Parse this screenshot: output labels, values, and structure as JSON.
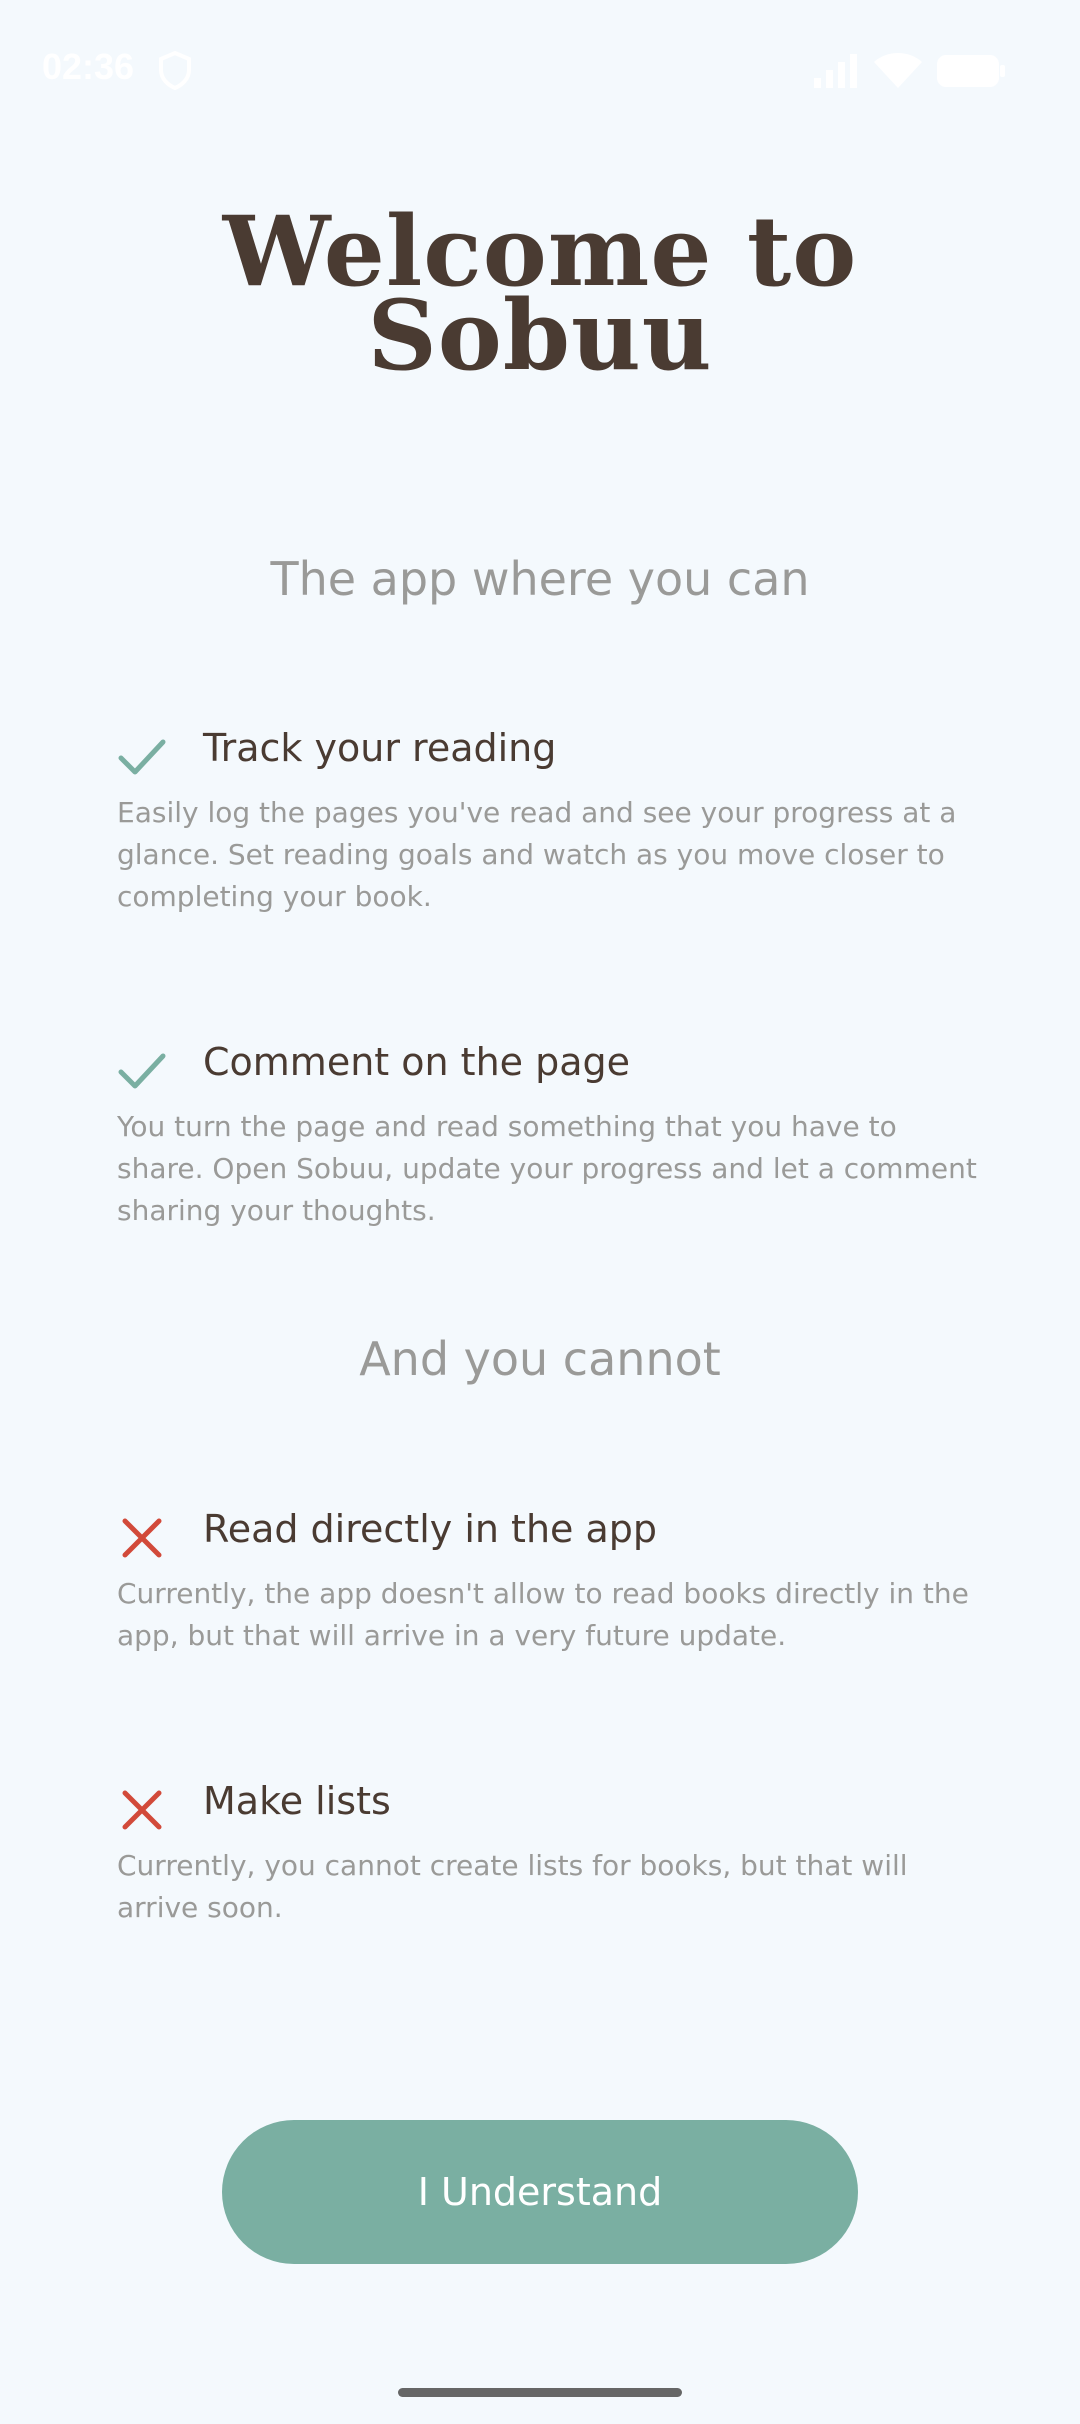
{
  "status_bar": {
    "time": "02:36",
    "icons": [
      "shield-icon",
      "signal-icon",
      "wifi-icon",
      "battery-icon"
    ]
  },
  "welcome": {
    "title_line1": "Welcome to",
    "title_line2": "Sobuu",
    "can_heading": "The app where you can",
    "cannot_heading": "And you cannot"
  },
  "can_items": [
    {
      "icon": "check-icon",
      "title": "Track your reading",
      "description": "Easily log the pages you've read and see your progress at a glance. Set reading goals and watch as you move closer to completing your book."
    },
    {
      "icon": "check-icon",
      "title": "Comment on the page",
      "description": "You turn the page and read something that you have to share. Open Sobuu, update your progress and let a comment sharing your thoughts."
    }
  ],
  "cannot_items": [
    {
      "icon": "cross-icon",
      "title": "Read directly in the app",
      "description": "Currently, the app doesn't allow to read books directly in the app, but that will arrive in a very future update."
    },
    {
      "icon": "cross-icon",
      "title": "Make lists",
      "description": "Currently, you cannot create lists for books, but that will arrive soon."
    }
  ],
  "cta": {
    "label": "I Understand"
  },
  "colors": {
    "background": "#f4f9fd",
    "title": "#4a3b32",
    "muted": "#9a9a98",
    "accent_green": "#7aafa2",
    "cross_red": "#d24a3a"
  }
}
